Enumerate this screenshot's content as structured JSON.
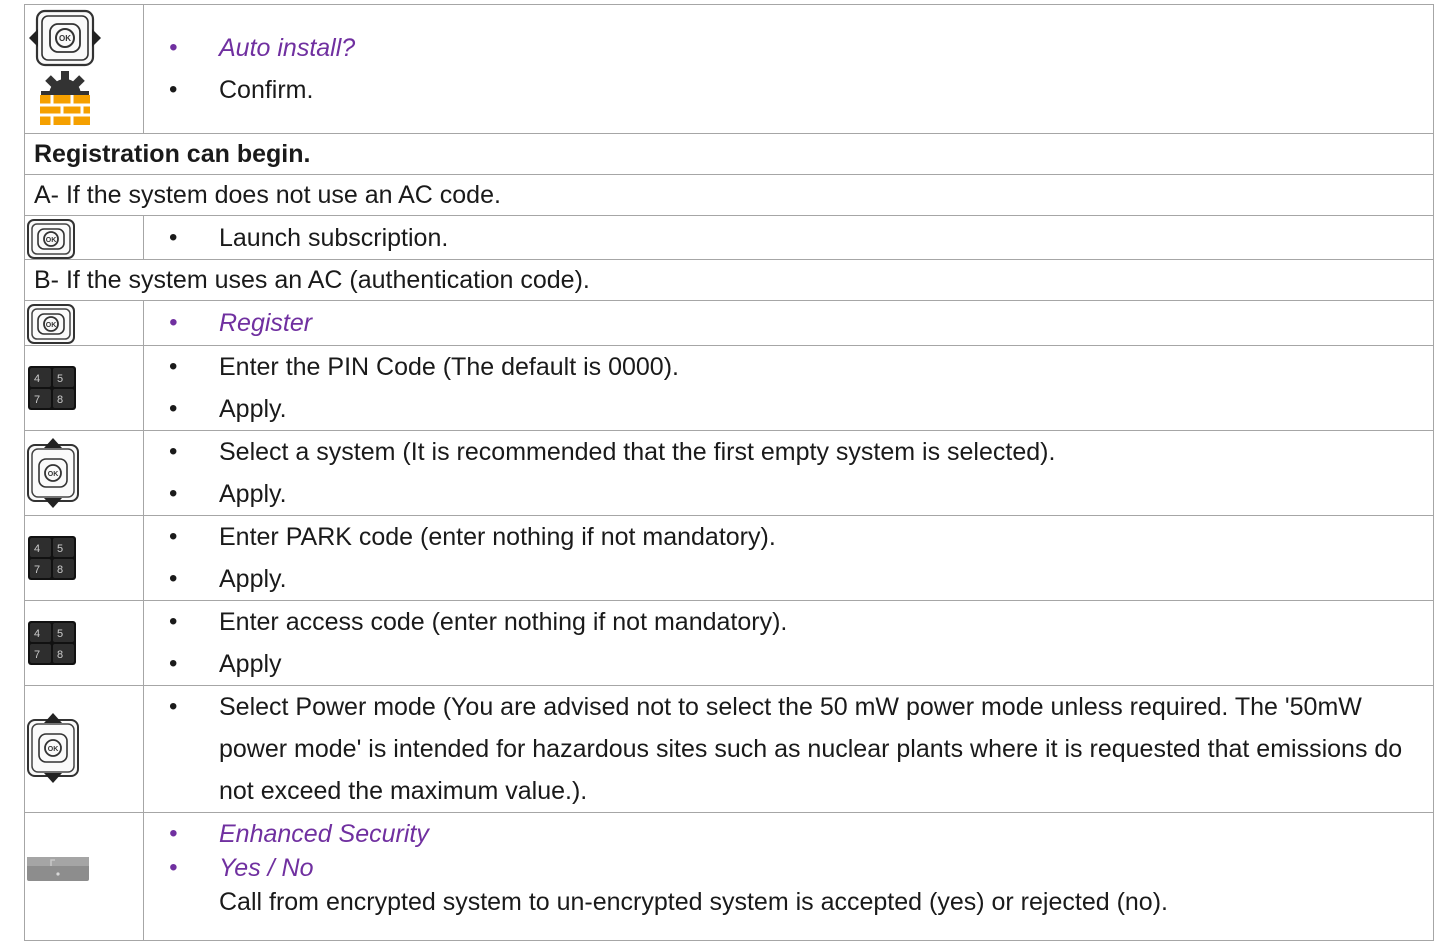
{
  "rows": {
    "auto_install": {
      "item1": "Auto install?",
      "item2": "Confirm."
    },
    "registration_begin": "Registration can begin.",
    "case_a": "A- If the system does not use an AC code.",
    "launch": "Launch subscription.",
    "case_b": "B- If the system uses an AC (authentication code).",
    "register": "Register",
    "pin": {
      "item1": "Enter the PIN Code (The default is 0000).",
      "item2": "Apply."
    },
    "select_system": {
      "item1": "Select a system (It is recommended that the first empty system is selected).",
      "item2": "Apply."
    },
    "park": {
      "item1": "Enter PARK code (enter nothing if not mandatory).",
      "item2": "Apply."
    },
    "access": {
      "item1": "Enter access code (enter nothing if not mandatory).",
      "item2": "Apply"
    },
    "power": {
      "item1": "Select Power mode (You are advised not to select the 50 mW power mode unless required. The '50mW power mode' is intended for hazardous sites such as nuclear plants where it is requested that emissions do not exceed the maximum value.)."
    },
    "security": {
      "item1": "Enhanced Security",
      "item2": "Yes / No",
      "note": "Call from encrypted system to un-encrypted system is accepted (yes) or rejected (no)."
    }
  },
  "keypad_labels": [
    "4",
    "5",
    "7",
    "8"
  ],
  "ok_label": "OK",
  "colors": {
    "accent_purple": "#7030a0",
    "border": "#a6a6a6",
    "gear_orange": "#f5a000"
  },
  "icons": [
    "ok-left-right-icon",
    "settings-gear-icon",
    "ok-key-icon",
    "keypad-icon",
    "ok-up-down-icon",
    "softkey-icon"
  ]
}
